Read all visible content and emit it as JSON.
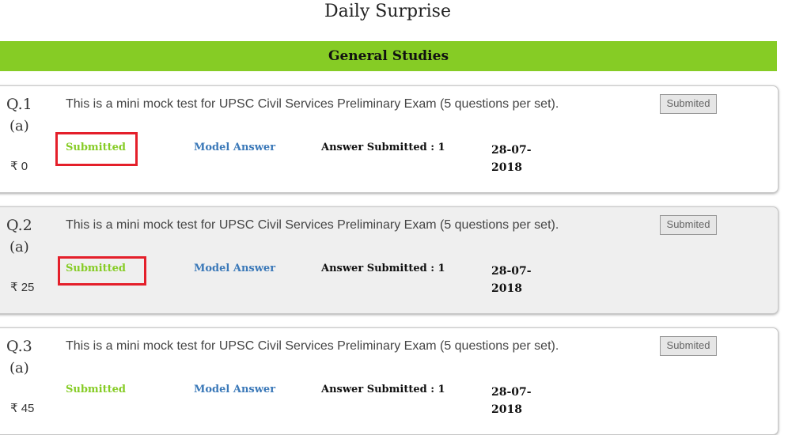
{
  "page": {
    "title": "Daily Surprise"
  },
  "section": {
    "title": "General Studies"
  },
  "questions": [
    {
      "number": "Q.1",
      "sub": "(a)",
      "price": "₹ 0",
      "description": "This is a mini mock test for UPSC Civil Services Preliminary Exam (5 questions per set).",
      "status": "Submitted",
      "model_answer": "Model Answer",
      "answer_submitted": "Answer Submitted : 1",
      "date": "28-07-2018",
      "button": "Submited"
    },
    {
      "number": "Q.2",
      "sub": "(a)",
      "price": "₹ 25",
      "description": "This is a mini mock test for UPSC Civil Services Preliminary Exam (5 questions per set).",
      "status": "Submitted",
      "model_answer": "Model Answer",
      "answer_submitted": "Answer Submitted : 1",
      "date": "28-07-2018",
      "button": "Submited"
    },
    {
      "number": "Q.3",
      "sub": "(a)",
      "price": "₹ 45",
      "description": "This is a mini mock test for UPSC Civil Services Preliminary Exam (5 questions per set).",
      "status": "Submitted",
      "model_answer": "Model Answer",
      "answer_submitted": "Answer Submitted : 1",
      "date": "28-07-2018",
      "button": "Submited"
    }
  ],
  "colors": {
    "banner": "#86cc25",
    "status_green": "#86cc25",
    "link_blue": "#3a78b8",
    "highlight_red": "#e41f2a"
  }
}
